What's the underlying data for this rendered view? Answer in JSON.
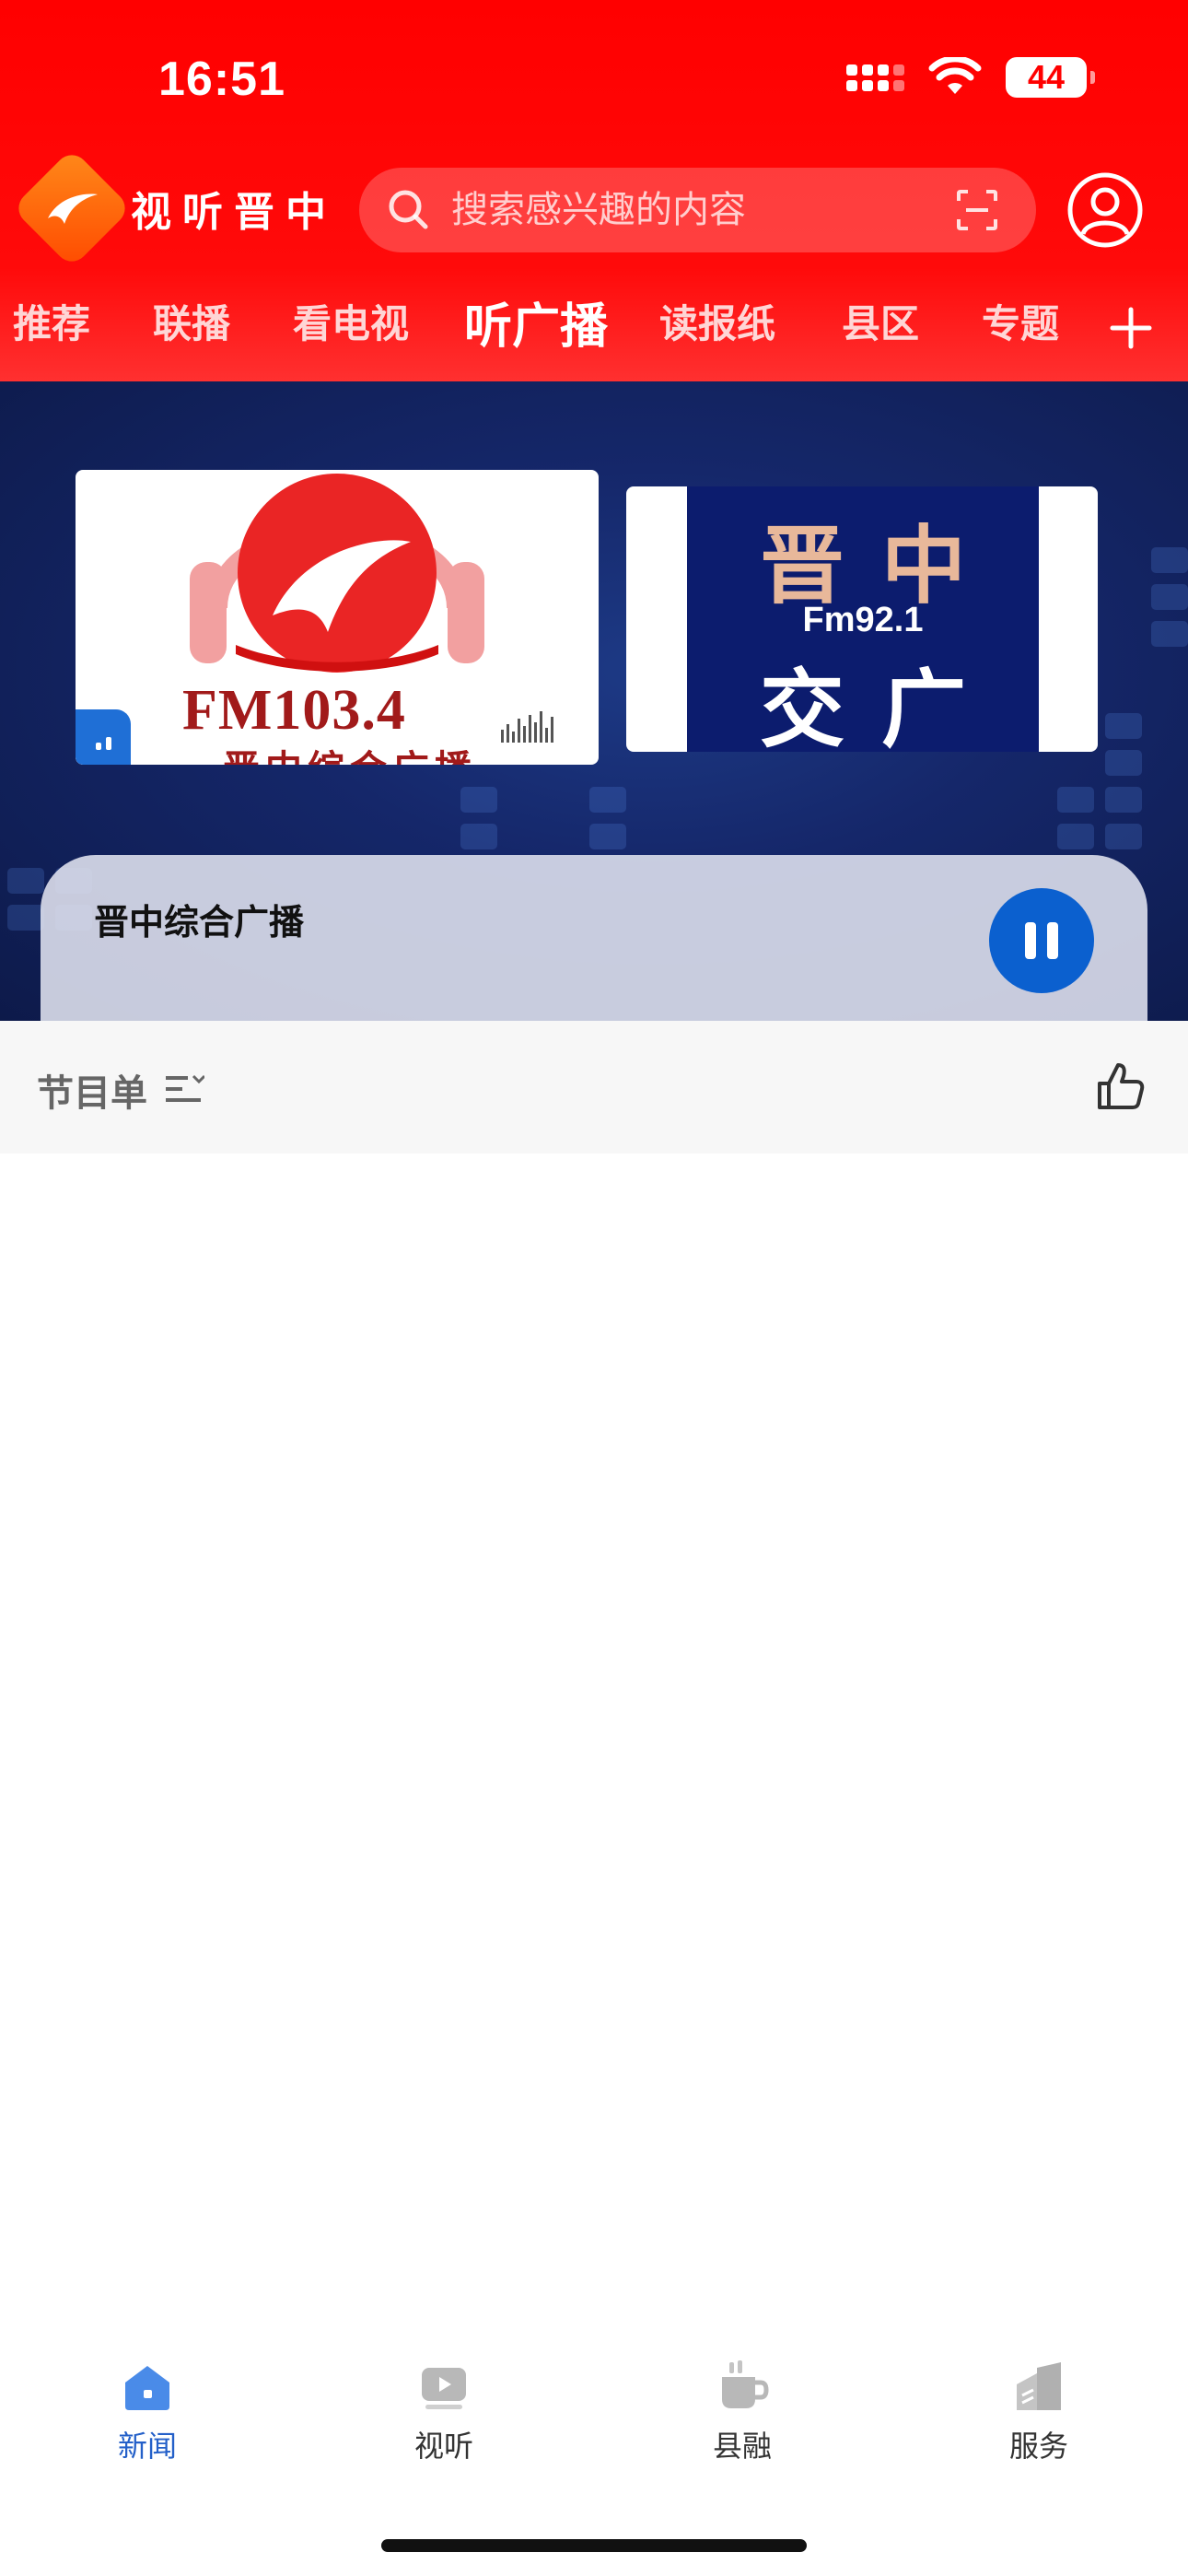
{
  "status_bar": {
    "time": "16:51",
    "battery": "44"
  },
  "header": {
    "brand": "视听晋中",
    "search_placeholder": "搜索感兴趣的内容"
  },
  "tabs": [
    {
      "label": "推荐"
    },
    {
      "label": "联播"
    },
    {
      "label": "看电视"
    },
    {
      "label": "听广播",
      "active": true
    },
    {
      "label": "读报纸"
    },
    {
      "label": "县区"
    },
    {
      "label": "专题"
    }
  ],
  "stations": [
    {
      "logo_text": "FM103.4",
      "logo_subtext": "晋中综合广播"
    },
    {
      "logo_title": "晋中",
      "logo_freq": "Fm92.1",
      "logo_bottom": "交广"
    }
  ],
  "player": {
    "current_station": "晋中综合广播"
  },
  "program_bar": {
    "label": "节目单"
  },
  "bottom_nav": [
    {
      "label": "新闻",
      "icon": "home-icon",
      "active": true
    },
    {
      "label": "视听",
      "icon": "play-icon"
    },
    {
      "label": "县融",
      "icon": "cup-icon"
    },
    {
      "label": "服务",
      "icon": "building-icon"
    }
  ],
  "colors": {
    "header_red": "#ff0000",
    "accent_blue": "#0b60cf",
    "nav_active": "#2460c9"
  }
}
